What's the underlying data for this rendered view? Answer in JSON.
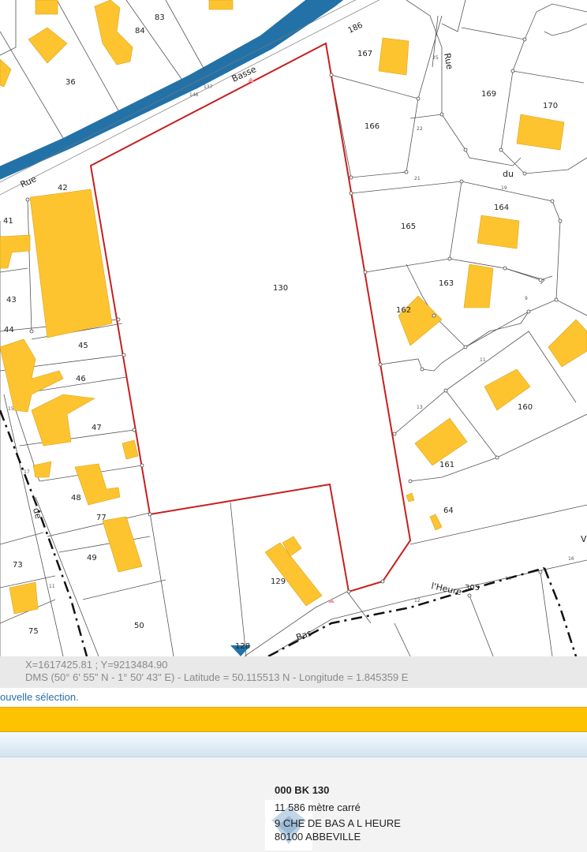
{
  "map": {
    "parcels": {
      "selected": "130",
      "p36": "36",
      "p83": "83",
      "p84": "84",
      "p186": "186",
      "p167": "167",
      "p166": "166",
      "p169": "169",
      "p170": "170",
      "p164": "164",
      "p165": "165",
      "p163": "163",
      "p162": "162",
      "p160": "160",
      "p161": "161",
      "p64": "64",
      "p42": "42",
      "p41": "41",
      "p43": "43",
      "p44": "44",
      "p45": "45",
      "p46": "46",
      "p47": "47",
      "p48": "48",
      "p77": "77",
      "p49": "49",
      "p73": "73",
      "p75": "75",
      "p50": "50",
      "p129": "129",
      "p305": "305",
      "p128": "128"
    },
    "streets": {
      "rue": "Rue",
      "basse": "Basse",
      "rue2": "Rue",
      "du": "du",
      "heure": "l'Heure",
      "bas": "Bas",
      "v": "V",
      "de": "de"
    },
    "colors": {
      "building": "#fdc430",
      "river": "#2272a8",
      "selection": "#c81e1e"
    }
  },
  "coords": {
    "xy": "X=1617425.81 ; Y=9213484.90",
    "dms": "DMS (50° 6' 55\" N - 1° 50' 43\" E) - Latitude = 50.115513 N - Longitude = 1.845359 E"
  },
  "selection_link": "ouvelle sélection.",
  "parcel_info": {
    "ref": "000 BK 130",
    "area": "11 586 mètre carré",
    "address1": "9 CHE DE BAS A L HEURE",
    "address2": "80100 ABBEVILLE"
  }
}
